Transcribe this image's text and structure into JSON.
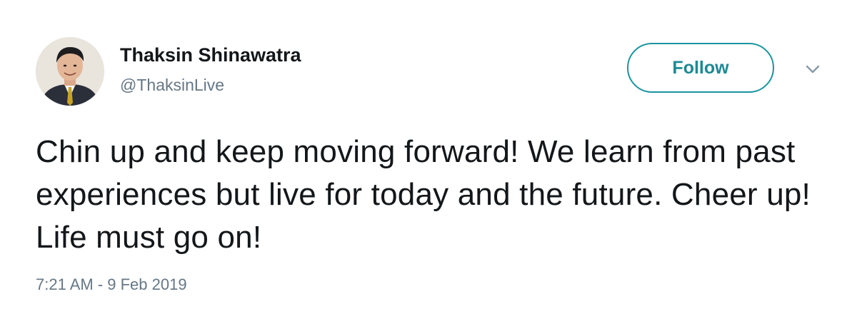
{
  "tweet": {
    "author": {
      "display_name": "Thaksin Shinawatra",
      "handle": "@ThaksinLive",
      "avatar_icon": "profile-photo"
    },
    "follow_label": "Follow",
    "menu_icon": "chevron-down-icon",
    "text": "Chin up and keep moving forward! We learn from past experiences but live for today and the future. Cheer up! Life must go on!",
    "timestamp": "7:21 AM - 9 Feb 2019"
  },
  "colors": {
    "accent": "#1b95a0",
    "name": "#14171a",
    "secondary": "#657786",
    "background": "#ffffff"
  }
}
